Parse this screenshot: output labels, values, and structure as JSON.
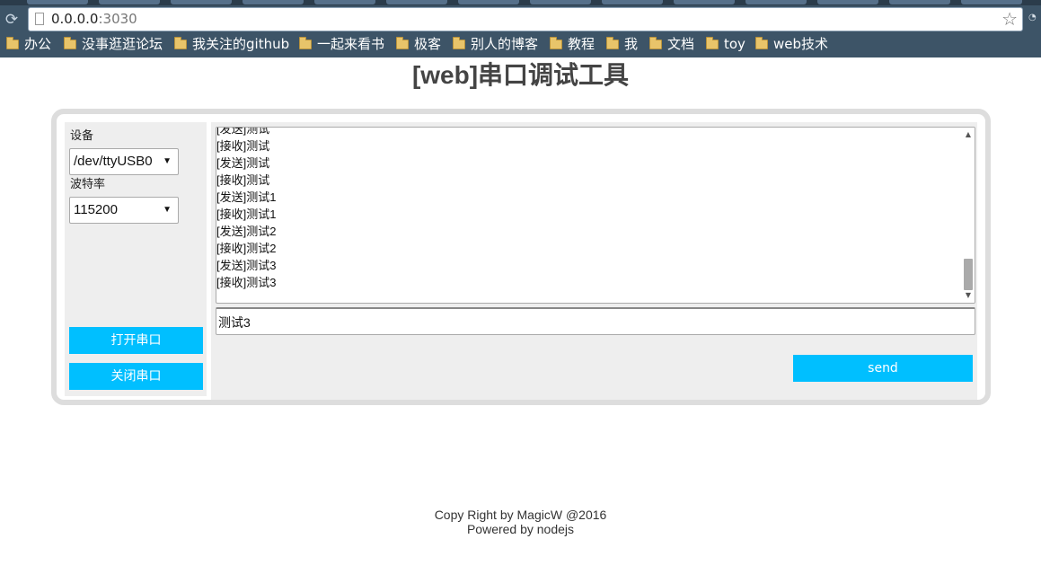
{
  "browser": {
    "url_host": "0.0.0.0",
    "url_port": ":3030",
    "bookmarks": [
      {
        "label": "办公"
      },
      {
        "label": "没事逛逛论坛"
      },
      {
        "label": "我关注的github"
      },
      {
        "label": "一起来看书"
      },
      {
        "label": "极客"
      },
      {
        "label": "别人的博客"
      },
      {
        "label": "教程"
      },
      {
        "label": "我"
      },
      {
        "label": "文档"
      },
      {
        "label": "toy"
      },
      {
        "label": "web技术"
      }
    ],
    "colors": {
      "chrome_bg": "#3d5467",
      "accent": "#00bfff"
    }
  },
  "page": {
    "title": "[web]串口调试工具"
  },
  "settings": {
    "device_label": "设备",
    "device_value": "/dev/ttyUSB0",
    "baud_label": "波特率",
    "baud_value": "115200",
    "open_button": "打开串口",
    "close_button": "关闭串口"
  },
  "log": {
    "lines": [
      "[发送]测试",
      "[接收]测试",
      "[发送]测试",
      "[接收]测试",
      "[发送]测试1",
      "[接收]测试1",
      "[发送]测试2",
      "[接收]测试2",
      "[发送]测试3",
      "[接收]测试3"
    ]
  },
  "composer": {
    "input_value": "测试3",
    "send_button": "send"
  },
  "footer": {
    "line1": "Copy Right by MagicW @2016",
    "line2": "Powered by nodejs"
  }
}
